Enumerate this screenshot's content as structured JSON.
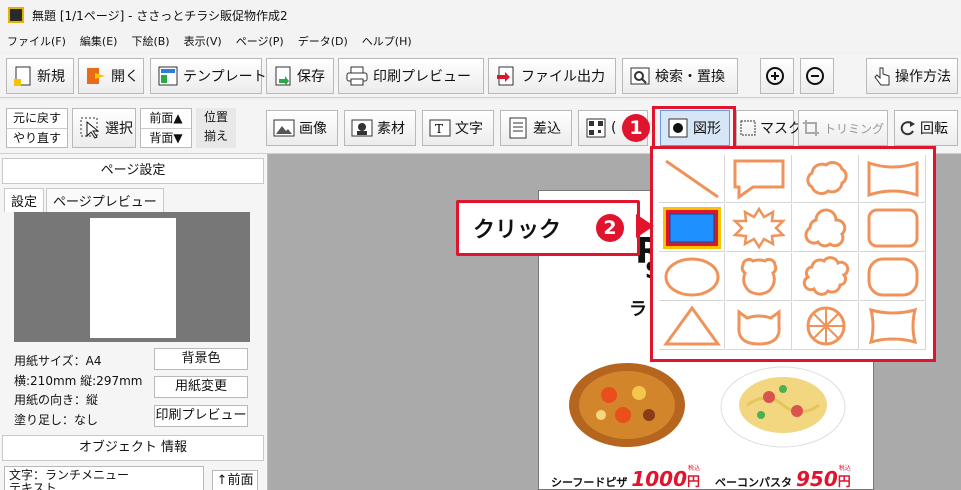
{
  "window": {
    "title": "無題 [1/1ページ] - ささっとチラシ販促物作成2"
  },
  "menu": [
    "ファイル(F)",
    "編集(E)",
    "下絵(B)",
    "表示(V)",
    "ページ(P)",
    "データ(D)",
    "ヘルプ(H)"
  ],
  "toolbar1": {
    "new": "新規",
    "open": "開く",
    "template": "テンプレート",
    "save": "保存",
    "print_preview": "印刷プレビュー",
    "file_output": "ファイル出力",
    "search_replace": "検索・置換",
    "zoom_in": "⊕",
    "zoom_out": "⊖",
    "howto": "操作方法"
  },
  "toolbar2": {
    "undo": "元に戻す",
    "redo": "やり直す",
    "select": "選択",
    "front": "前面▲",
    "back": "背面▼",
    "align_top": "位置",
    "align_bottom": "揃え",
    "image": "画像",
    "material": "素材",
    "text": "文字",
    "insert": "差込",
    "qr": "(",
    "shape": "図形",
    "mask": "マスク",
    "trimming": "トリミング",
    "rotate": "回転"
  },
  "left_panel": {
    "page_settings_header": "ページ設定",
    "tab_settings": "設定",
    "tab_page_preview": "ページプレビュー",
    "paper_size": "用紙サイズ：A4",
    "dimensions": "横:210mm 縦:297mm",
    "orientation": "用紙の向き：縦",
    "bleed": "塗り足し：なし",
    "btn_bg_color": "背景色",
    "btn_paper_change": "用紙変更",
    "btn_print_preview": "印刷プレビュー",
    "object_info_header": "オブジェクト 情報",
    "object_text": "文字：ランチメニュー",
    "object_text2": "テキスト",
    "btn_front": "↑前面"
  },
  "document": {
    "partial_letter_1": "R",
    "partial_letter_2": "S",
    "partial_letter_3": "ラ",
    "item1_name": "シーフードピザ",
    "item1_price": "1000",
    "item1_unit": "円",
    "item1_tax": "税込",
    "item2_name": "ベーコンパスタ",
    "item2_price": "950",
    "item2_unit": "円",
    "item2_tax": "税込"
  },
  "annotations": {
    "badge1": "1",
    "badge2": "2",
    "callout_text": "クリック"
  },
  "colors": {
    "accent_red": "#e0142c",
    "shape_stroke": "#f0935a",
    "selected_fill": "#1e90ff"
  }
}
